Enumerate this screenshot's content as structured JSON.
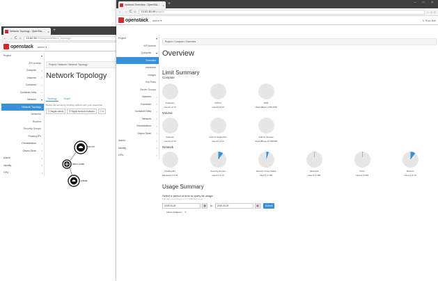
{
  "back_window": {
    "tab_title": "Network Topology - OpenSta...",
    "url_host": "10.62.35.",
    "url_path": "99/project/network_topology/",
    "header": {
      "logo": "openstack",
      "project": "admin ▾"
    },
    "sidebar": [
      {
        "label": "Project",
        "kind": "top",
        "chev": "▾"
      },
      {
        "label": "API Access",
        "kind": "sub"
      },
      {
        "label": "Compute",
        "kind": "item",
        "chev": "›"
      },
      {
        "label": "Volumes",
        "kind": "item",
        "chev": "›"
      },
      {
        "label": "Container",
        "kind": "item",
        "chev": "›"
      },
      {
        "label": "Container Infra",
        "kind": "item",
        "chev": "›"
      },
      {
        "label": "Network",
        "kind": "item",
        "chev": "▾"
      },
      {
        "label": "Network Topology",
        "kind": "active"
      },
      {
        "label": "Networks",
        "kind": "sub"
      },
      {
        "label": "Routers",
        "kind": "sub"
      },
      {
        "label": "Security Groups",
        "kind": "sub"
      },
      {
        "label": "Floating IPs",
        "kind": "sub"
      },
      {
        "label": "Orchestration",
        "kind": "item",
        "chev": "›"
      },
      {
        "label": "Object Store",
        "kind": "item",
        "chev": "›"
      },
      {
        "label": "Admin",
        "kind": "top",
        "chev": "›"
      },
      {
        "label": "Identity",
        "kind": "top",
        "chev": "›"
      },
      {
        "label": "GPU",
        "kind": "top",
        "chev": "›"
      }
    ],
    "breadcrumb": "Project / Network / Network Topology",
    "page_title": "Network Topology",
    "tabs": [
      "Topology",
      "Graph"
    ],
    "hint": "Resize the canvas by scrolling up/down with your mouse/trac",
    "buttons": [
      "☐ Toggle Labels",
      "☰ Toggle Network Collapse",
      "☐ C"
    ],
    "nodes": [
      {
        "label": "ext-net",
        "kind": "network"
      },
      {
        "label": "demo-router",
        "kind": "router"
      },
      {
        "label": "private",
        "kind": "network"
      }
    ]
  },
  "front_window": {
    "tab_title": "Instance Overview - OpenSta...",
    "url_host": "10.62.35.99",
    "url_path": "/project/",
    "addr_right": "··· ☆ ☆",
    "header": {
      "logo": "openstack",
      "project": "admin ▾",
      "user": "↳ Root Bell"
    },
    "sidebar": [
      {
        "label": "Project",
        "kind": "top",
        "chev": "▾"
      },
      {
        "label": "API Access",
        "kind": "sub"
      },
      {
        "label": "Compute",
        "kind": "item",
        "chev": "▾"
      },
      {
        "label": "Overview",
        "kind": "active"
      },
      {
        "label": "Instances",
        "kind": "sub"
      },
      {
        "label": "Images",
        "kind": "sub"
      },
      {
        "label": "Key Pairs",
        "kind": "sub"
      },
      {
        "label": "Server Groups",
        "kind": "sub"
      },
      {
        "label": "Volumes",
        "kind": "item",
        "chev": "›"
      },
      {
        "label": "Container",
        "kind": "item",
        "chev": "›"
      },
      {
        "label": "Container Infra",
        "kind": "item",
        "chev": "›"
      },
      {
        "label": "Network",
        "kind": "item",
        "chev": "›"
      },
      {
        "label": "Orchestration",
        "kind": "item",
        "chev": "›"
      },
      {
        "label": "Object Store",
        "kind": "item",
        "chev": "›"
      },
      {
        "label": "Admin",
        "kind": "top",
        "chev": "›"
      },
      {
        "label": "Identity",
        "kind": "top",
        "chev": "›"
      },
      {
        "label": "GPU",
        "kind": "top",
        "chev": "›"
      }
    ],
    "breadcrumb": "Project / Compute / Overview",
    "page_title": "Overview",
    "limit_summary": {
      "title": "Limit Summary",
      "sections": [
        {
          "title": "Compute",
          "items": [
            {
              "label": "Instances",
              "used": "Used 0 of 10",
              "fraction": 0
            },
            {
              "label": "VCPUs",
              "used": "Used 0 of 20",
              "fraction": 0
            },
            {
              "label": "RAM",
              "used": "Used 0Bytes of 50.0GB",
              "fraction": 0
            }
          ]
        },
        {
          "title": "Volume",
          "items": [
            {
              "label": "Volumes",
              "used": "Used 0 of 10",
              "fraction": 0
            },
            {
              "label": "Volume Snapshots",
              "used": "Used 0 of 10",
              "fraction": 0
            },
            {
              "label": "Volume Storage",
              "used": "Used 0Bytes of 1000GB",
              "fraction": 0
            }
          ]
        },
        {
          "title": "Network",
          "items": [
            {
              "label": "Floating IPs",
              "used": "Allocated 0 of 50",
              "fraction": 0
            },
            {
              "label": "Security Groups",
              "used": "Used 1 of 10",
              "fraction": 0.1
            },
            {
              "label": "Security Group Rules",
              "used": "Used 5 of 100",
              "fraction": 0.05
            },
            {
              "label": "Networks",
              "used": "Used 1 of 100",
              "fraction": 0.01
            },
            {
              "label": "Ports",
              "used": "Used 2 of 500",
              "fraction": 0.004
            },
            {
              "label": "Routers",
              "used": "Used 1 of 10",
              "fraction": 0.1
            }
          ]
        }
      ]
    },
    "usage": {
      "title": "Usage Summary",
      "hint": "Select a period of time to query its usage:",
      "note": "The date should be in YYYY-MM-DD format.",
      "from": "2019-04-29",
      "to": "2019-04-29",
      "to_label": "to",
      "calendar_icon": "calendar-icon",
      "submit": "Submit",
      "active_instances_label": "Active Instances:",
      "active_instances_value": "0"
    },
    "colors": {
      "accent": "#3a8fd9",
      "brand": "#d8272d",
      "pie_bg": "#e6e6e6"
    }
  }
}
